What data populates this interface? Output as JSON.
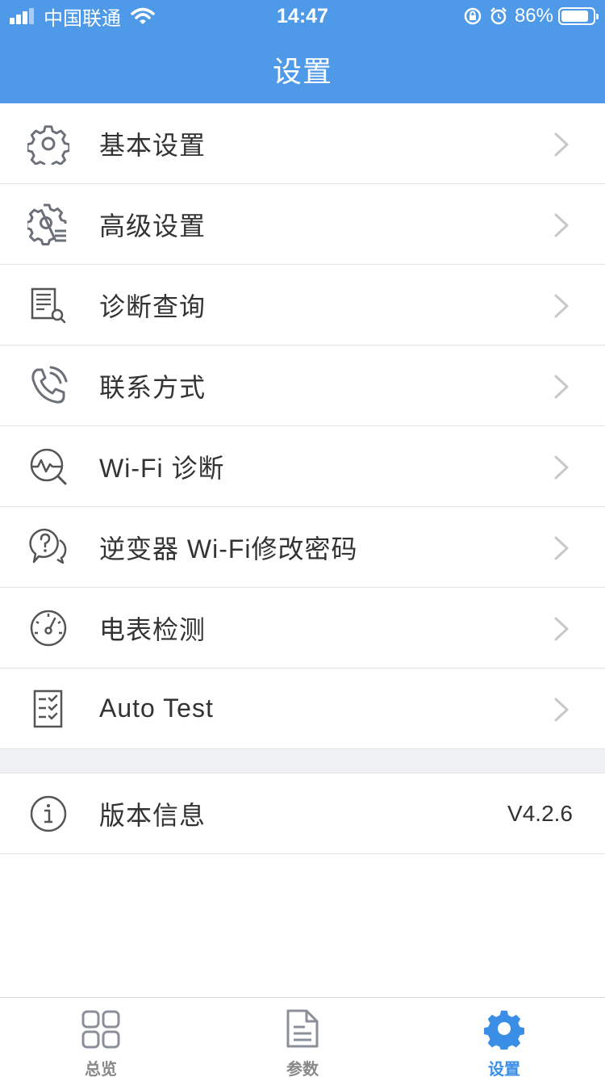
{
  "status_bar": {
    "carrier": "中国联通",
    "time": "14:47",
    "battery": "86%",
    "battery_level": 0.86
  },
  "header": {
    "title": "设置"
  },
  "menu": {
    "items": [
      {
        "label": "基本设置",
        "icon": "gear-icon"
      },
      {
        "label": "高级设置",
        "icon": "gear-list-icon"
      },
      {
        "label": "诊断查询",
        "icon": "document-search-icon"
      },
      {
        "label": "联系方式",
        "icon": "phone-icon"
      },
      {
        "label": "Wi-Fi 诊断",
        "icon": "pulse-search-icon"
      },
      {
        "label": "逆变器 Wi-Fi修改密码",
        "icon": "question-chat-icon"
      },
      {
        "label": "电表检测",
        "icon": "meter-gauge-icon"
      },
      {
        "label": "Auto Test",
        "icon": "checklist-icon"
      }
    ]
  },
  "version": {
    "label": "版本信息",
    "value": "V4.2.6",
    "icon": "info-icon"
  },
  "tabs": [
    {
      "label": "总览",
      "icon": "grid-icon",
      "active": false
    },
    {
      "label": "参数",
      "icon": "document-icon",
      "active": false
    },
    {
      "label": "设置",
      "icon": "settings-gear-icon",
      "active": true
    }
  ],
  "colors": {
    "header": "#4f9ae8",
    "active_tab": "#3a8ee6",
    "icon_gray": "#666666"
  }
}
